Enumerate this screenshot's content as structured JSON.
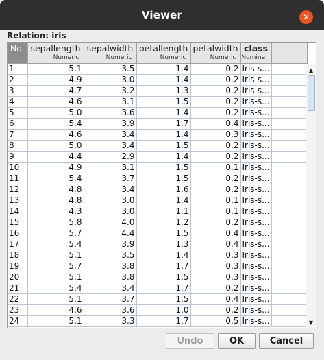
{
  "window": {
    "title": "Viewer",
    "close_label": "✕"
  },
  "relation_label": "Relation: iris",
  "headers": [
    {
      "name": "No.",
      "type": ""
    },
    {
      "name": "sepallength",
      "type": "Numeric"
    },
    {
      "name": "sepalwidth",
      "type": "Numeric"
    },
    {
      "name": "petallength",
      "type": "Numeric"
    },
    {
      "name": "petalwidth",
      "type": "Numeric"
    },
    {
      "name": "class",
      "type": "Nominal"
    }
  ],
  "rows": [
    [
      "1",
      "5.1",
      "3.5",
      "1.4",
      "0.2",
      "Iris-s..."
    ],
    [
      "2",
      "4.9",
      "3.0",
      "1.4",
      "0.2",
      "Iris-s..."
    ],
    [
      "3",
      "4.7",
      "3.2",
      "1.3",
      "0.2",
      "Iris-s..."
    ],
    [
      "4",
      "4.6",
      "3.1",
      "1.5",
      "0.2",
      "Iris-s..."
    ],
    [
      "5",
      "5.0",
      "3.6",
      "1.4",
      "0.2",
      "Iris-s..."
    ],
    [
      "6",
      "5.4",
      "3.9",
      "1.7",
      "0.4",
      "Iris-s..."
    ],
    [
      "7",
      "4.6",
      "3.4",
      "1.4",
      "0.3",
      "Iris-s..."
    ],
    [
      "8",
      "5.0",
      "3.4",
      "1.5",
      "0.2",
      "Iris-s..."
    ],
    [
      "9",
      "4.4",
      "2.9",
      "1.4",
      "0.2",
      "Iris-s..."
    ],
    [
      "10",
      "4.9",
      "3.1",
      "1.5",
      "0.1",
      "Iris-s..."
    ],
    [
      "11",
      "5.4",
      "3.7",
      "1.5",
      "0.2",
      "Iris-s..."
    ],
    [
      "12",
      "4.8",
      "3.4",
      "1.6",
      "0.2",
      "Iris-s..."
    ],
    [
      "13",
      "4.8",
      "3.0",
      "1.4",
      "0.1",
      "Iris-s..."
    ],
    [
      "14",
      "4.3",
      "3.0",
      "1.1",
      "0.1",
      "Iris-s..."
    ],
    [
      "15",
      "5.8",
      "4.0",
      "1.2",
      "0.2",
      "Iris-s..."
    ],
    [
      "16",
      "5.7",
      "4.4",
      "1.5",
      "0.4",
      "Iris-s..."
    ],
    [
      "17",
      "5.4",
      "3.9",
      "1.3",
      "0.4",
      "Iris-s..."
    ],
    [
      "18",
      "5.1",
      "3.5",
      "1.4",
      "0.3",
      "Iris-s..."
    ],
    [
      "19",
      "5.7",
      "3.8",
      "1.7",
      "0.3",
      "Iris-s..."
    ],
    [
      "20",
      "5.1",
      "3.8",
      "1.5",
      "0.3",
      "Iris-s..."
    ],
    [
      "21",
      "5.4",
      "3.4",
      "1.7",
      "0.2",
      "Iris-s..."
    ],
    [
      "22",
      "5.1",
      "3.7",
      "1.5",
      "0.4",
      "Iris-s..."
    ],
    [
      "23",
      "4.6",
      "3.6",
      "1.0",
      "0.2",
      "Iris-s..."
    ],
    [
      "24",
      "5.1",
      "3.3",
      "1.7",
      "0.5",
      "Iris-s..."
    ]
  ],
  "buttons": {
    "undo": "Undo",
    "ok": "OK",
    "cancel": "Cancel"
  },
  "colors": {
    "titlebar": "#2f2f2f",
    "close": "#e95420",
    "header_no": "#8d8d8d"
  }
}
